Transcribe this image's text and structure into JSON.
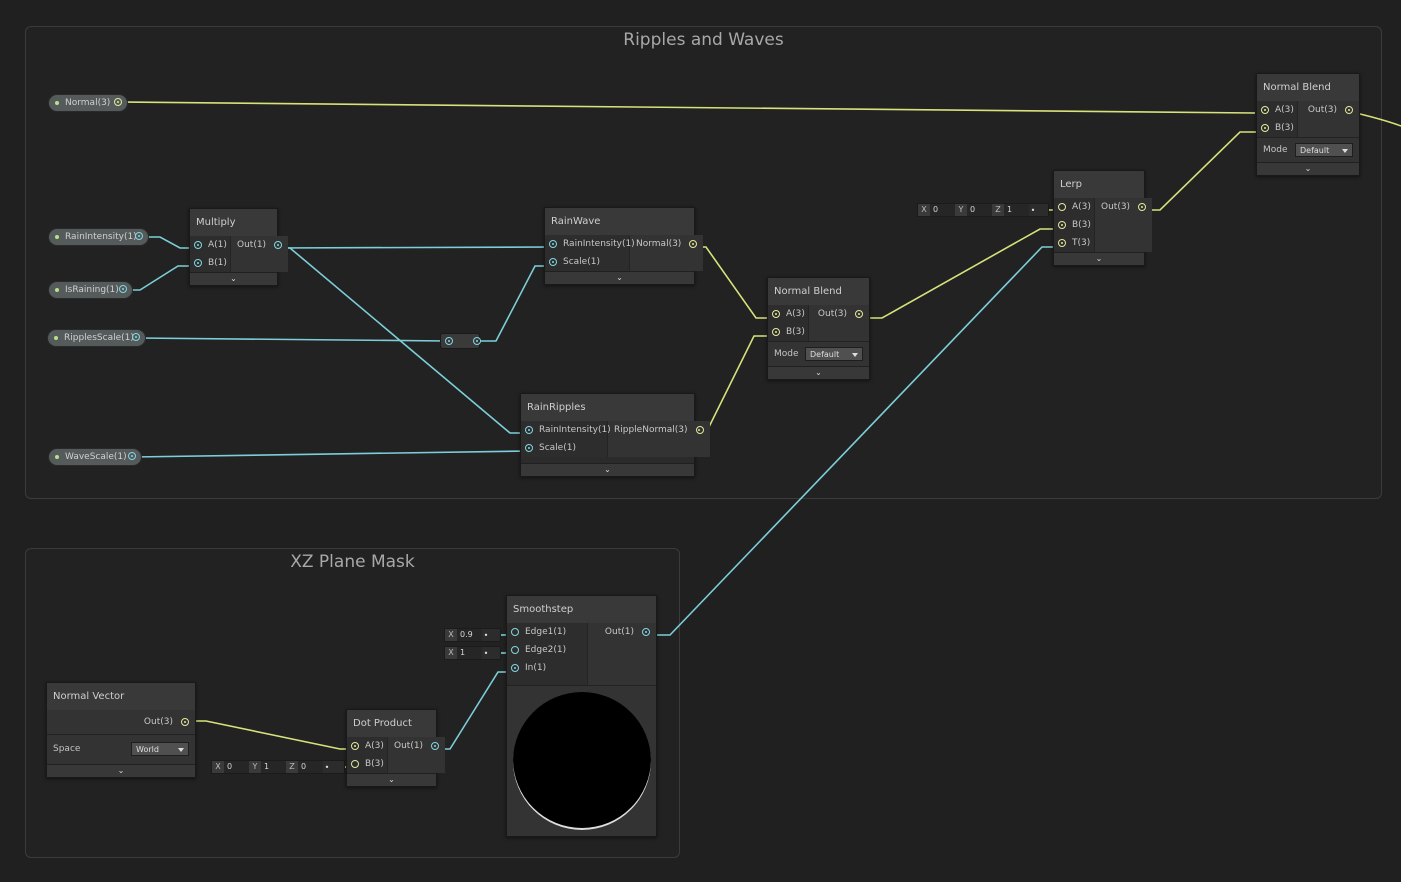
{
  "groups": {
    "ripples": {
      "title": "Ripples and Waves"
    },
    "xz_mask": {
      "title": "XZ Plane Mask"
    }
  },
  "colors": {
    "vector_wire": "#d8e27a",
    "float_wire": "#7ccfd9",
    "background": "#202020"
  },
  "properties": [
    {
      "id": "normal",
      "label": "Normal(3)"
    },
    {
      "id": "rain_intensity",
      "label": "RainIntensity(1)"
    },
    {
      "id": "is_raining",
      "label": "IsRaining(1)"
    },
    {
      "id": "ripples_scale",
      "label": "RipplesScale(1)"
    },
    {
      "id": "wave_scale",
      "label": "WaveScale(1)"
    }
  ],
  "nodes": {
    "multiply": {
      "title": "Multiply",
      "inputs": [
        "A(1)",
        "B(1)"
      ],
      "outputs": [
        "Out(1)"
      ]
    },
    "rain_wave": {
      "title": "RainWave",
      "inputs": [
        "RainIntensity(1)",
        "Scale(1)"
      ],
      "outputs": [
        "Normal(3)"
      ]
    },
    "rain_ripples": {
      "title": "RainRipples",
      "inputs": [
        "RainIntensity(1)",
        "Scale(1)"
      ],
      "outputs": [
        "RippleNormal(3)"
      ]
    },
    "normal_blend_1": {
      "title": "Normal Blend",
      "inputs": [
        "A(3)",
        "B(3)"
      ],
      "outputs": [
        "Out(3)"
      ],
      "mode_label": "Mode",
      "mode_value": "Default"
    },
    "normal_blend_2": {
      "title": "Normal Blend",
      "inputs": [
        "A(3)",
        "B(3)"
      ],
      "outputs": [
        "Out(3)"
      ],
      "mode_label": "Mode",
      "mode_value": "Default"
    },
    "lerp": {
      "title": "Lerp",
      "inputs": [
        "A(3)",
        "B(3)",
        "T(3)"
      ],
      "outputs": [
        "Out(3)"
      ]
    },
    "normal_vector": {
      "title": "Normal Vector",
      "outputs": [
        "Out(3)"
      ],
      "space_label": "Space",
      "space_value": "World"
    },
    "dot_product": {
      "title": "Dot Product",
      "inputs": [
        "A(3)",
        "B(3)"
      ],
      "outputs": [
        "Out(1)"
      ]
    },
    "smoothstep": {
      "title": "Smoothstep",
      "inputs": [
        "Edge1(1)",
        "Edge2(1)",
        "In(1)"
      ],
      "outputs": [
        "Out(1)"
      ]
    }
  },
  "inline_values": {
    "lerp_a": {
      "x_label": "X",
      "x": "0",
      "y_label": "Y",
      "y": "0",
      "z_label": "Z",
      "z": "1"
    },
    "dot_b": {
      "x_label": "X",
      "x": "0",
      "y_label": "Y",
      "y": "1",
      "z_label": "Z",
      "z": "0"
    },
    "edge1": {
      "x_label": "X",
      "x": "0.9"
    },
    "edge2": {
      "x_label": "X",
      "x": "1"
    }
  },
  "icons": {
    "expand": "chevron-down-icon",
    "port": "port-dot-icon"
  }
}
